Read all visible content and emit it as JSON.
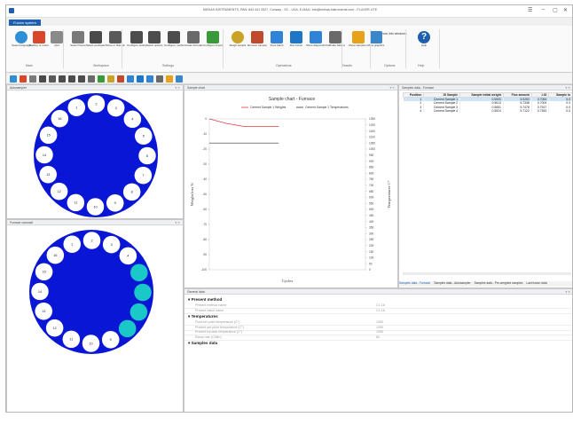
{
  "window": {
    "title": "NIEKAS INSTRUMENTS, PAN: 843 441 2527, Conway - SC - USA, E-MAIL: info@niekas-instruments.com - FLUXER LITE",
    "app_tab": "Fusion system"
  },
  "ribbon": {
    "buttons": [
      {
        "label": "Select language",
        "icon": "globe-icon",
        "color": "#2f8fd6"
      },
      {
        "label": "Backup or restore",
        "icon": "backup-icon",
        "color": "#d9472b"
      },
      {
        "label": "Quit",
        "icon": "quit-icon",
        "color": "#8a8a8a"
      },
      {
        "label": "Select theme",
        "icon": "theme-icon",
        "color": "#7a7a7a"
      },
      {
        "label": "Select workspace",
        "icon": "workspace-icon",
        "color": "#4a4a4a"
      },
      {
        "label": "Show or hide windows",
        "icon": "windows-icon",
        "color": "#5a5a5a"
      },
      {
        "label": "Configure settings",
        "icon": "settings-icon",
        "color": "#4d4d4d"
      },
      {
        "label": "Select options",
        "icon": "options-icon",
        "color": "#4d4d4d"
      },
      {
        "label": "Configure method",
        "icon": "method-icon",
        "color": "#4d4d4d"
      },
      {
        "label": "Create formulas",
        "icon": "formula-icon",
        "color": "#6a6a6a"
      },
      {
        "label": "Configure imports / exports",
        "icon": "import-export-icon",
        "color": "#3a9a3a"
      },
      {
        "label": "Weigh sample",
        "icon": "weigh-icon",
        "color": "#c9a227"
      },
      {
        "label": "Remove samples",
        "icon": "remove-icon",
        "color": "#c04a2c"
      },
      {
        "label": "Fuse batch",
        "icon": "fuse-icon",
        "color": "#2f84d8"
      },
      {
        "label": "Run fusion",
        "icon": "run-icon",
        "color": "#1e76c8"
      },
      {
        "label": "Show diagnostics",
        "icon": "diagnostics-icon",
        "color": "#2f84d8"
      },
      {
        "label": "Calibrate balances",
        "icon": "calibrate-icon",
        "color": "#6a6a6a"
      },
      {
        "label": "Show samples results",
        "icon": "results-icon",
        "color": "#e8a21a"
      },
      {
        "label": "View graphics",
        "icon": "graphics-icon",
        "color": "#3a86c9"
      },
      {
        "label": "Help",
        "icon": "help-icon",
        "color": "#1e5fb0"
      }
    ],
    "groups": [
      "Main",
      "Workspace",
      "Settings",
      "Operations",
      "Results",
      "Options",
      "Help"
    ],
    "show_info_label": "Show info windows"
  },
  "panels": {
    "autosampler_title": "Autosampler",
    "carousel_title": "Furnace carousel",
    "chart_title": "Sample chart",
    "samples_title": "Samples data - Furnace",
    "general_title": "General data"
  },
  "autosampler": {
    "positions": [
      "1",
      "2",
      "3",
      "4",
      "5",
      "6",
      "7",
      "8",
      "9",
      "10",
      "11",
      "12",
      "13",
      "14",
      "15",
      "16"
    ],
    "filled": []
  },
  "carousel": {
    "positions": [
      "1",
      "2",
      "3",
      "4",
      "5",
      "6",
      "7",
      "8",
      "9",
      "10",
      "11",
      "12",
      "13",
      "14",
      "15",
      "16"
    ],
    "filled": [
      2,
      3,
      4,
      5
    ]
  },
  "chart_data": {
    "type": "line",
    "title": "Sample chart - Furnace",
    "xlabel": "Cycles",
    "ylabel": "Weight loss %",
    "y2label": "Temperatures C°",
    "ylim": [
      -100,
      0
    ],
    "y2lim": [
      0,
      1250
    ],
    "y_ticks": [
      "0",
      "-10",
      "-20",
      "-30",
      "-40",
      "-50",
      "-60",
      "-70",
      "-80",
      "-90",
      "-100"
    ],
    "y2_ticks": [
      "1250",
      "1200",
      "1150",
      "1100",
      "1050",
      "1000",
      "950",
      "900",
      "850",
      "800",
      "750",
      "700",
      "650",
      "600",
      "550",
      "500",
      "450",
      "400",
      "350",
      "300",
      "250",
      "200",
      "150",
      "100",
      "50",
      "0"
    ],
    "series": [
      {
        "name": "Cement Sample 1 Weights",
        "color": "#e03a3a",
        "x": [
          0,
          1,
          2,
          3,
          4
        ],
        "values": [
          0,
          -3,
          -5,
          -5,
          -5
        ],
        "axis": "y"
      },
      {
        "name": "Cement Sample 1 Temperatures",
        "color": "#333333",
        "x": [
          0,
          1,
          2,
          3,
          4
        ],
        "values": [
          1050,
          1050,
          1050,
          1050,
          1050
        ],
        "axis": "y2"
      }
    ]
  },
  "samples_table": {
    "columns": [
      "Position",
      "ID Sample",
      "Sample initial weight",
      "Flux amount",
      "LOI",
      "Sample lo"
    ],
    "rows": [
      [
        "1",
        "Cement Sample 1",
        "0.5000",
        "5.0253",
        "0.7064",
        "0.0"
      ],
      [
        "2",
        "Cement Sample 2",
        "0.5613",
        "5.7338",
        "0.7004",
        "0.0"
      ],
      [
        "3",
        "Cement Sample 3",
        "0.5651",
        "5.7478",
        "0.7517",
        "0.0"
      ],
      [
        "4",
        "Cement Sample 4",
        "0.5524",
        "5.7122",
        "0.7543",
        "0.0"
      ]
    ],
    "tabs": [
      "Samples data - Furnace",
      "Samples data - Autosampler",
      "Samples data - Pre-weighed samples",
      "Last fusion data"
    ]
  },
  "general_data": {
    "sections": [
      {
        "title": "Present method",
        "rows": [
          [
            "Present method name",
            "C1-16"
          ],
          [
            "Present batch name",
            "C1-16"
          ]
        ]
      },
      {
        "title": "Temperatures",
        "rows": [
          [
            "Fluid set point temperature (C°)",
            "1050"
          ],
          [
            "Present set point temperature (C°)",
            "1050"
          ],
          [
            "Present furnace temperature (C°)",
            "1050"
          ],
          [
            "Ramp rate (C/Min)",
            "80"
          ]
        ]
      },
      {
        "title": "Samples data",
        "rows": []
      }
    ]
  }
}
